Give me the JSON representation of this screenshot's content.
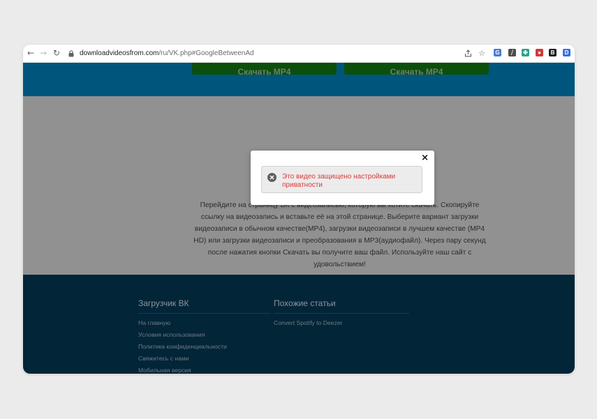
{
  "browser": {
    "url_host": "downloadvideosfrom.com",
    "url_path": "/ru/VK.php#GoogleBetweenAd",
    "extensions": [
      {
        "icon": "translate-extension-icon",
        "glyph": "G",
        "color": "#4a7cd6"
      },
      {
        "icon": "pen-extension-icon",
        "glyph": "⧸",
        "color": "#4d4d4d"
      },
      {
        "icon": "leaf-extension-icon",
        "glyph": "✤",
        "color": "#2aa48a"
      },
      {
        "icon": "pokeball-extension-icon",
        "glyph": "●",
        "color": "#d23a3a"
      },
      {
        "icon": "b-extension-icon",
        "glyph": "B",
        "color": "#1f1f1f"
      },
      {
        "icon": "d-extension-icon",
        "glyph": "D",
        "color": "#3b6fe0"
      }
    ]
  },
  "download_buttons": [
    {
      "label": "Скачать MP4"
    },
    {
      "label": "Скачать MP4"
    }
  ],
  "description": "Перейдите на страницу ВК с видеозаписью, которую вы хотите скачать. Скопируйте ссылку на видеозапись и вставьте её на этой странице. Выберите вариант загрузки видеозаписи в обычном качестве(MP4), загрузки видеозаписи в лучшем качестве (MP4 HD) или загрузки видеозаписи и преобразования в MP3(аудиофайл). Через пару секунд после нажатия кнопки Скачать вы получите ваш файл. Используйте наш сайт с удовольствием!",
  "footer": {
    "col1": {
      "title": "Загрузчик ВК",
      "links": [
        "На главную",
        "Условия использования",
        "Политика конфиденциальности",
        "Свяжитесь с нами",
        "Мобильная версия"
      ]
    },
    "col2": {
      "title": "Похожие статьи",
      "links": [
        "Convert Spotify to Deezer"
      ]
    }
  },
  "modal": {
    "close_glyph": "×",
    "message": "Это видео защищено настройками приватности"
  },
  "colors": {
    "error_text": "#d93838",
    "page_blue": "#00557c",
    "footer_bg": "#022538"
  }
}
